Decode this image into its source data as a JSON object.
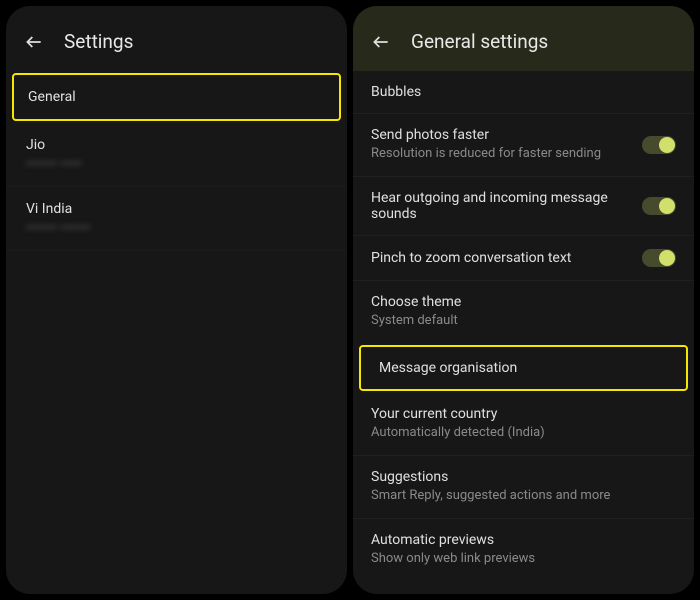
{
  "left": {
    "title": "Settings",
    "items": [
      {
        "label": "General",
        "highlighted": true
      },
      {
        "label": "Jio",
        "sub_blur": "blurred-text"
      },
      {
        "label": "Vi India",
        "sub_blur": "blurred-text"
      }
    ]
  },
  "right": {
    "title": "General settings",
    "rows": [
      {
        "label": "Bubbles"
      },
      {
        "label": "Send photos faster",
        "sub": "Resolution is reduced for faster sending",
        "toggle": true
      },
      {
        "label": "Hear outgoing and incoming message sounds",
        "toggle": true
      },
      {
        "label": "Pinch to zoom conversation text",
        "toggle": true
      },
      {
        "label": "Choose theme",
        "sub": "System default"
      },
      {
        "label": "Message organisation",
        "highlighted": true
      },
      {
        "label": "Your current country",
        "sub": "Automatically detected (India)"
      },
      {
        "label": "Suggestions",
        "sub": "Smart Reply, suggested actions and more"
      },
      {
        "label": "Automatic previews",
        "sub": "Show only web link previews"
      }
    ]
  }
}
